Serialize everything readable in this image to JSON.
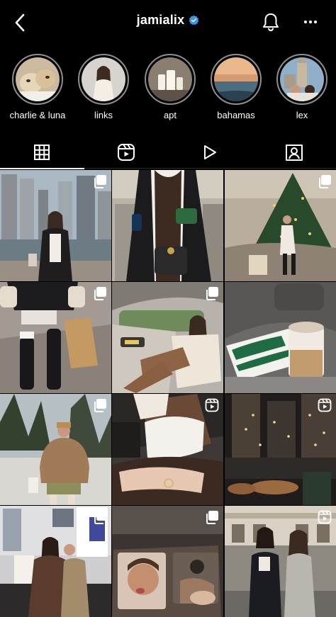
{
  "header": {
    "username": "jamialix",
    "back_icon": "chevron-left-icon",
    "verified_icon": "verified-badge-icon",
    "bell_icon": "bell-icon",
    "more_icon": "more-horizontal-icon"
  },
  "highlights": [
    {
      "label": "charlie & luna",
      "icon": "dogs-photo"
    },
    {
      "label": "links",
      "icon": "portrait-photo"
    },
    {
      "label": "apt",
      "icon": "candles-photo"
    },
    {
      "label": "bahamas",
      "icon": "beach-photo"
    },
    {
      "label": "lex",
      "icon": "city-photo"
    }
  ],
  "tabs": [
    {
      "icon": "grid-icon",
      "active": true
    },
    {
      "icon": "reels-icon",
      "active": false
    },
    {
      "icon": "play-icon",
      "active": false
    },
    {
      "icon": "tagged-icon",
      "active": false
    }
  ],
  "posts": [
    {
      "type": "carousel",
      "icon": "carousel-icon",
      "scene": "city-outfit"
    },
    {
      "type": "image",
      "icon": "",
      "scene": "varsity-jacket"
    },
    {
      "type": "carousel",
      "icon": "carousel-icon",
      "scene": "christmas-tree"
    },
    {
      "type": "carousel",
      "icon": "carousel-icon",
      "scene": "boots-bag"
    },
    {
      "type": "carousel",
      "icon": "carousel-icon",
      "scene": "car-seat"
    },
    {
      "type": "image",
      "icon": "",
      "scene": "coffee-cup"
    },
    {
      "type": "carousel",
      "icon": "carousel-icon",
      "scene": "puffer-jacket"
    },
    {
      "type": "reel",
      "icon": "reel-icon",
      "scene": "sneakers"
    },
    {
      "type": "reel",
      "icon": "reel-icon",
      "scene": "cafe-night"
    },
    {
      "type": "carousel",
      "icon": "carousel-icon",
      "scene": "friends-hallway"
    },
    {
      "type": "carousel",
      "icon": "carousel-icon",
      "scene": "mirror-selfie"
    },
    {
      "type": "reel",
      "icon": "reel-icon",
      "scene": "street-friends"
    }
  ],
  "colors": {
    "background": "#000000",
    "verified": "#3897f0",
    "ring": "#8e8e8e",
    "divider": "#262626"
  }
}
